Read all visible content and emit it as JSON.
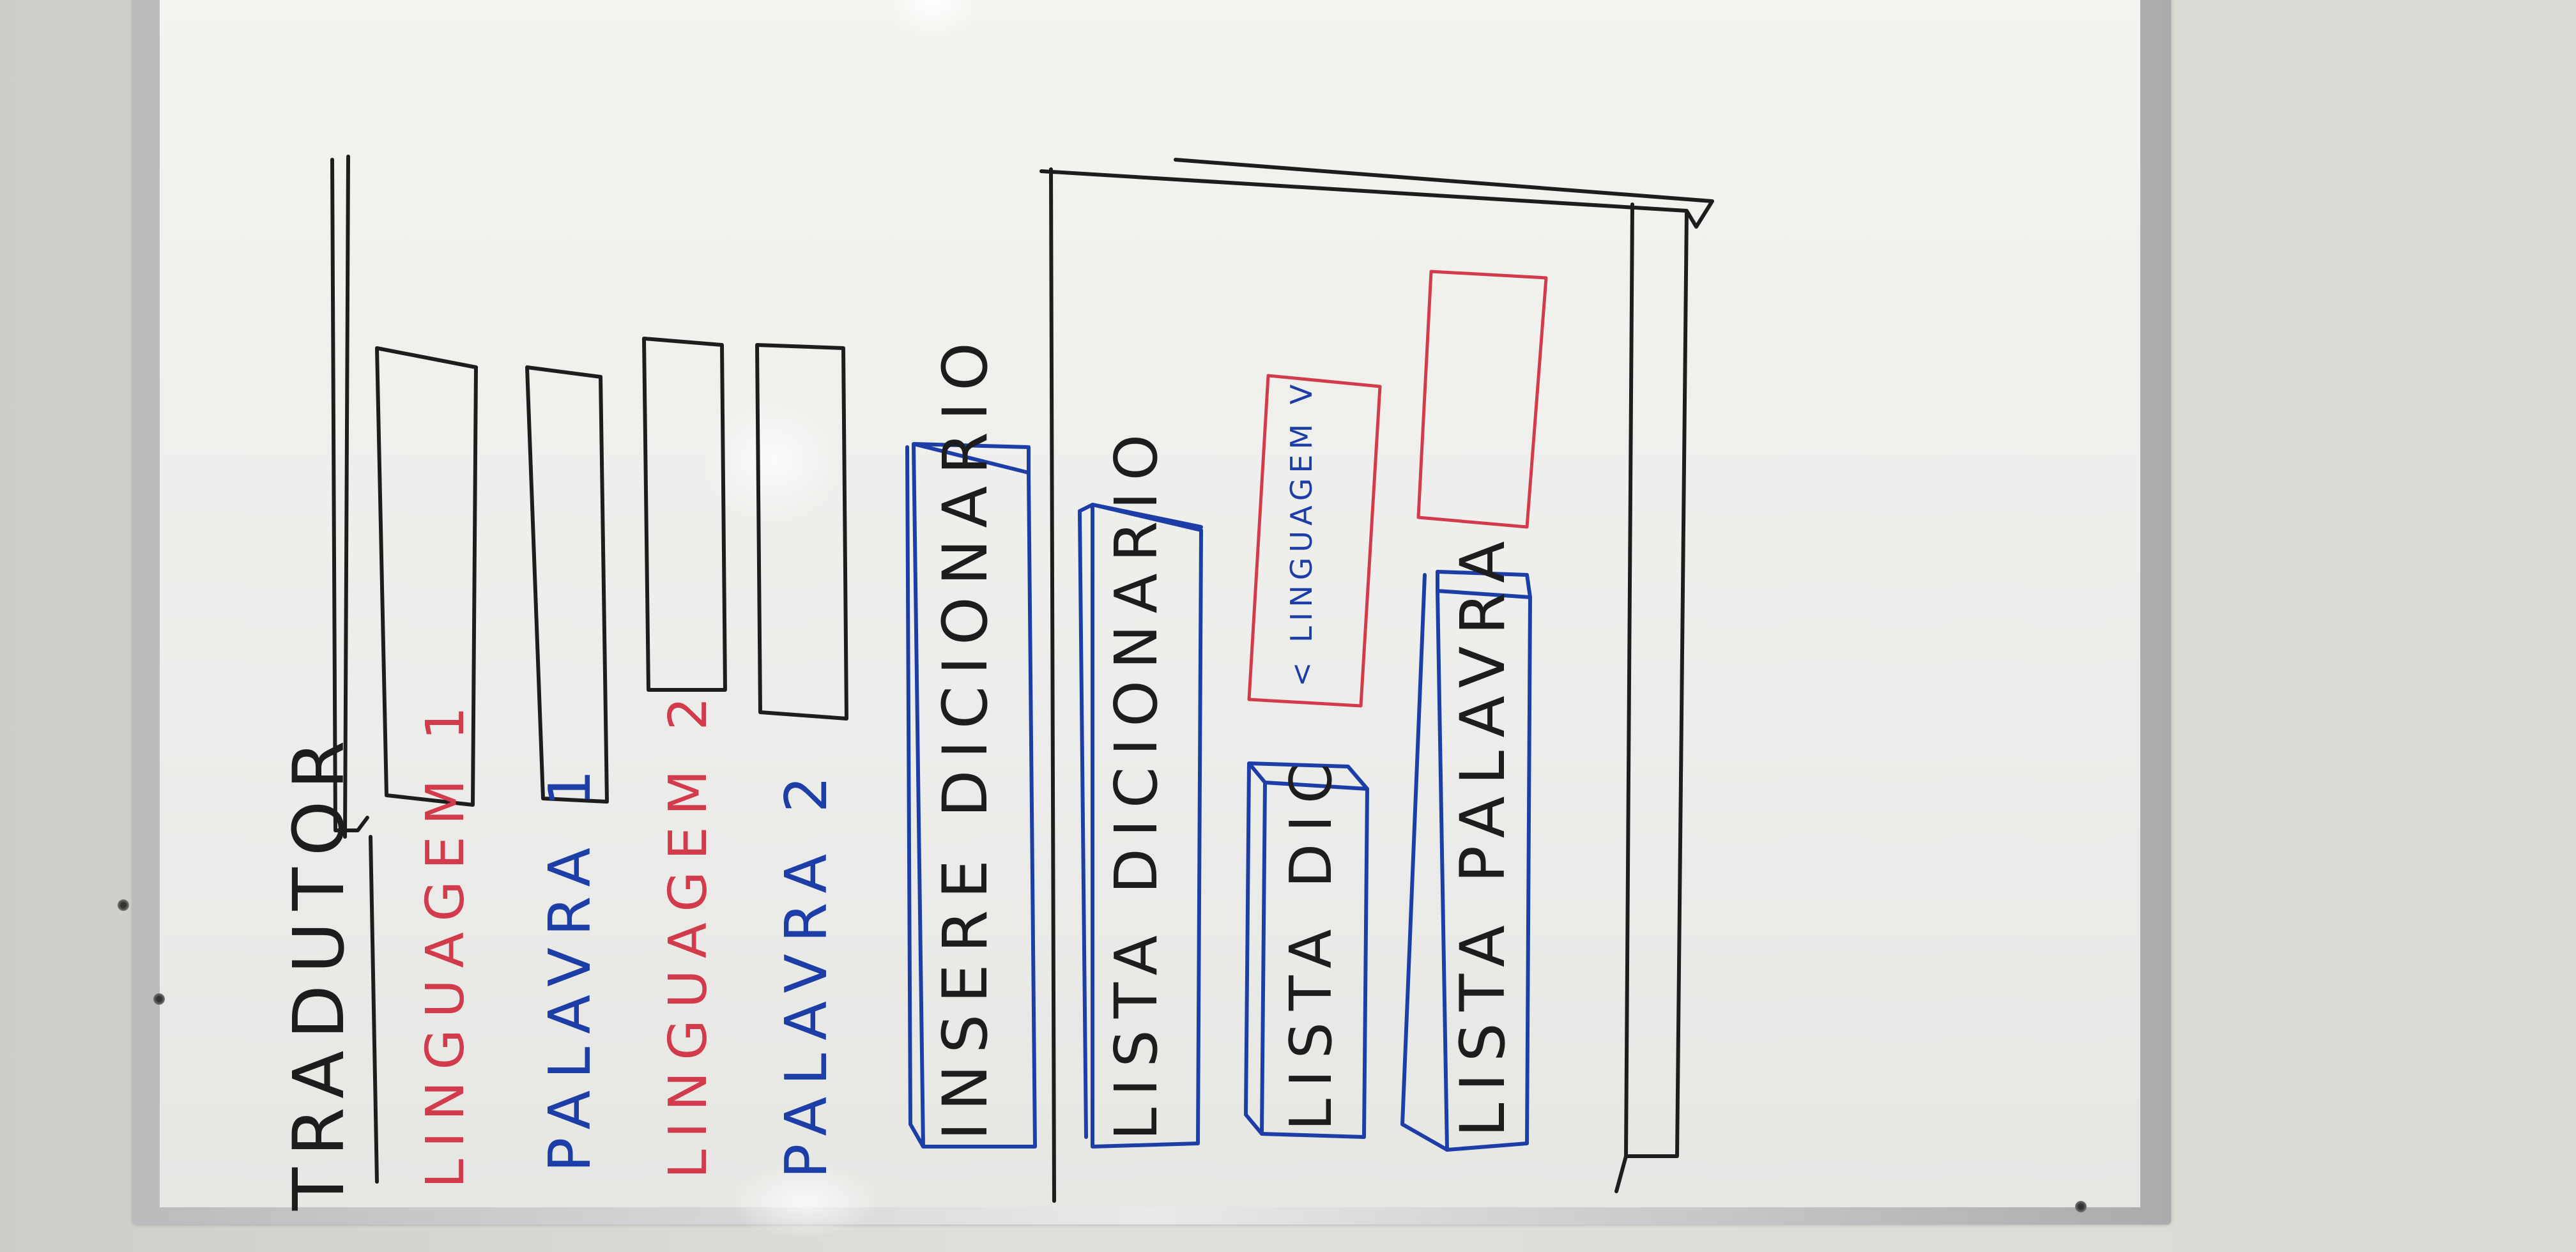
{
  "labels": {
    "title": "TRADUTOR",
    "lang1": "LINGUAGEM 1",
    "word1": "PALAVRA 1",
    "lang2": "LINGUAGEM 2",
    "word2": "PALAVRA 2",
    "insert_dict": "INSERE DICIONARIO",
    "list_dict": "LISTA DICIONARIO",
    "list_dic": "LISTA DIC",
    "lang_combo": "< LINGUAGEM V",
    "list_word": "LISTA PALAVRA"
  },
  "colors": {
    "black_ink": "#1d1d1d",
    "blue_ink": "#1c3ea6",
    "red_ink": "#d23b4c"
  }
}
